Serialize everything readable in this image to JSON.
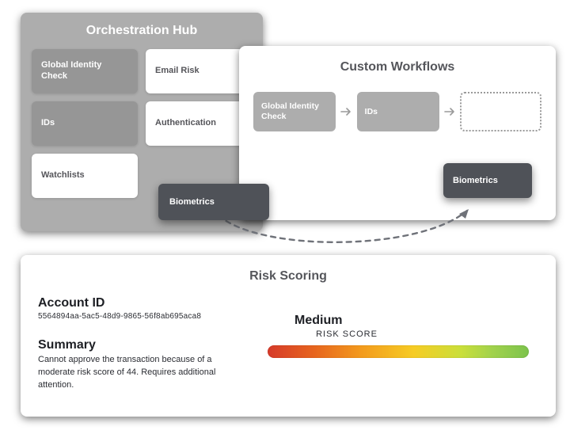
{
  "hub": {
    "title": "Orchestration Hub",
    "tiles": [
      {
        "label": "Global Identity Check",
        "style": "filled"
      },
      {
        "label": "Email Risk",
        "style": "outlined"
      },
      {
        "label": "IDs",
        "style": "filled"
      },
      {
        "label": "Authentication",
        "style": "outlined"
      },
      {
        "label": "Watchlists",
        "style": "outlined"
      }
    ],
    "biometrics_label": "Biometrics"
  },
  "workflows": {
    "title": "Custom Workflows",
    "steps": [
      {
        "label": "Global Identity Check"
      },
      {
        "label": "IDs"
      }
    ],
    "biometrics_label": "Biometrics"
  },
  "risk": {
    "title": "Risk Scoring",
    "account_id_label": "Account ID",
    "account_id_value": "5564894aa-5ac5-48d9-9865-56f8ab695aca8",
    "summary_label": "Summary",
    "summary_text": "Cannot approve the transaction because of a moderate risk score of 44. Requires additional attention.",
    "level": "Medium",
    "caption": "RISK SCORE"
  }
}
